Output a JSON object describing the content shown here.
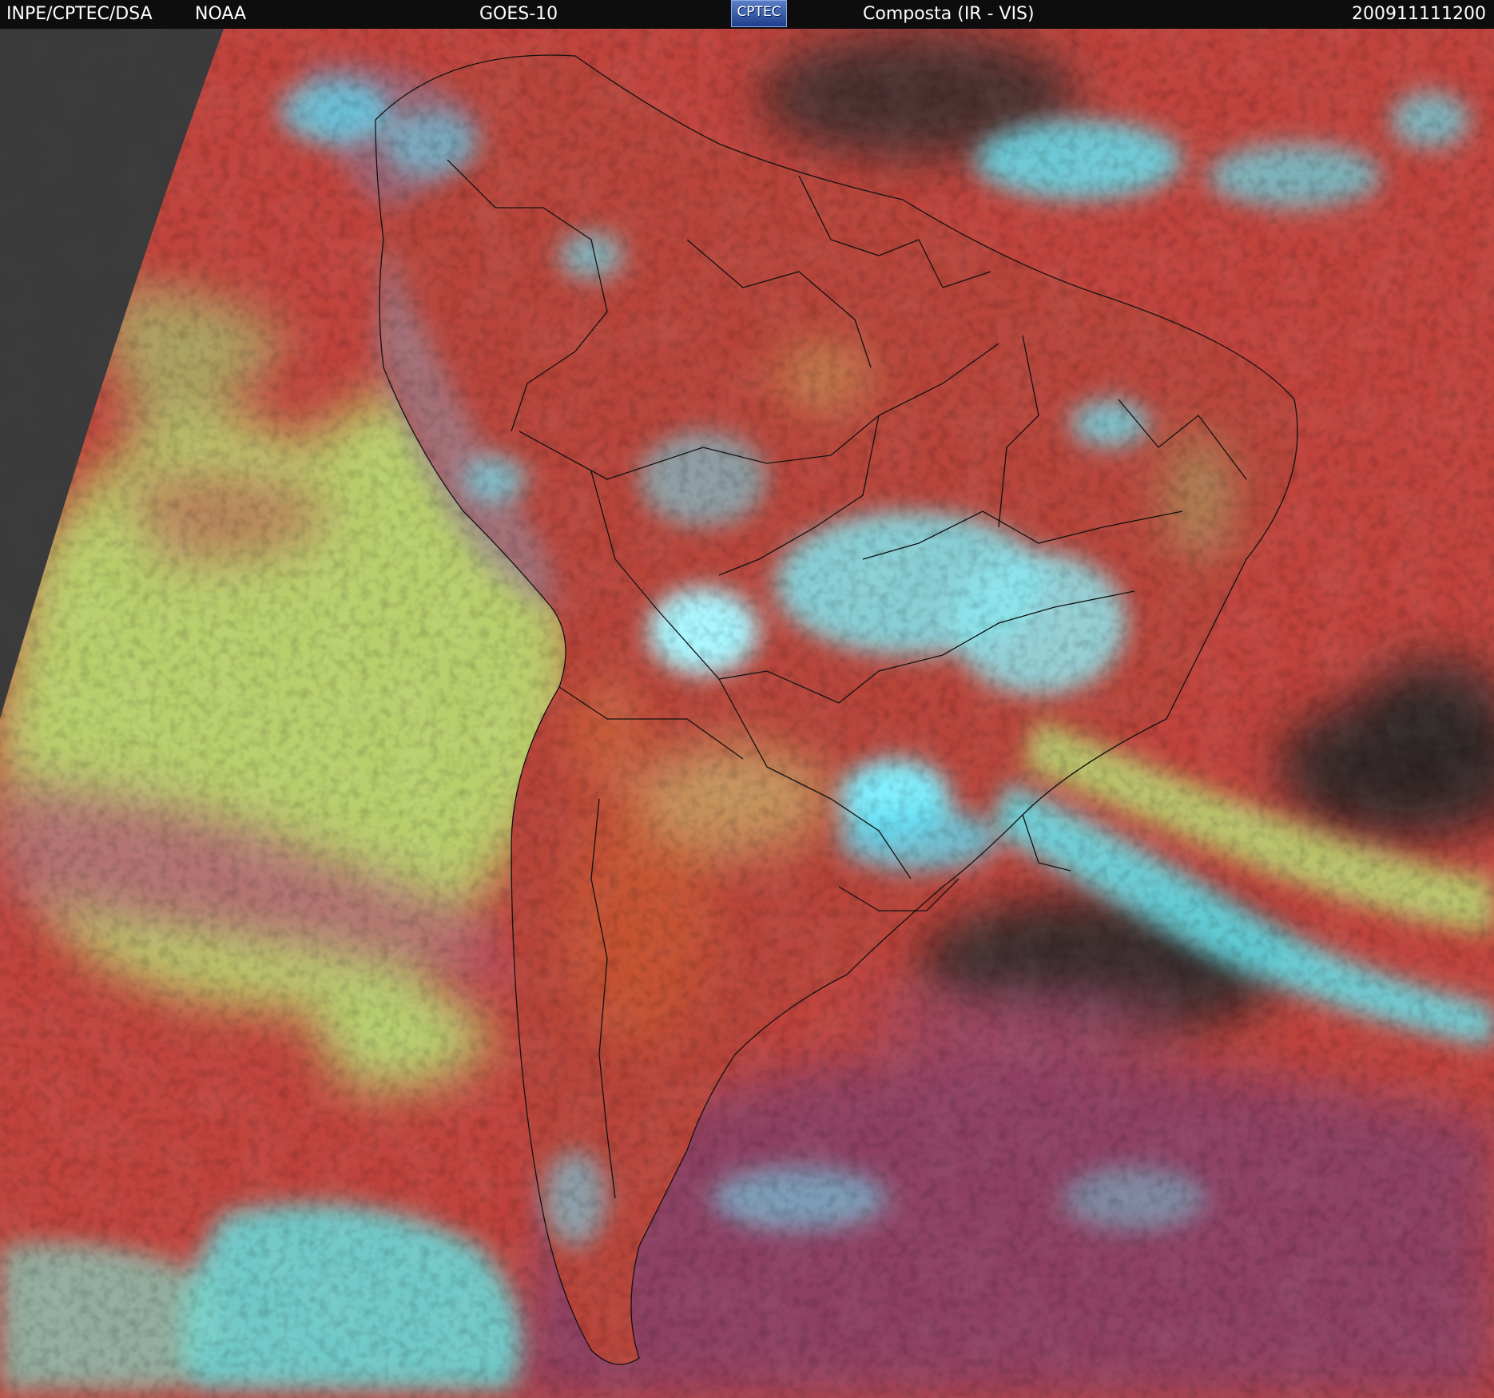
{
  "header": {
    "institution": "INPE/CPTEC/DSA",
    "agency": "NOAA",
    "satellite": "GOES-10",
    "logo_text": "CPTEC",
    "product": "Composta (IR - VIS)",
    "timestamp": "200911111200"
  },
  "colors": {
    "land": "#b8443a",
    "ocean": "#c0433c",
    "low_cloud": "#b7cf6a",
    "high_cloud": "#5fe6f0",
    "clear_sky_dark": "#2a2a2a",
    "off_disk": "#3a3a3a",
    "southern_ocean": "#8a3c5c",
    "border_lines": "#111111"
  }
}
